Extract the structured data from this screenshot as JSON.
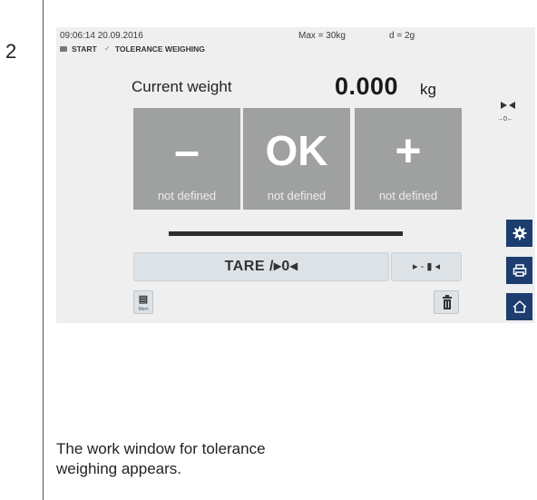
{
  "step": {
    "number": "2"
  },
  "status": {
    "datetime": "09:06:14 20.09.2016",
    "max": "Max = 30kg",
    "d": "d = 2g"
  },
  "app_bar": {
    "start_label": "START",
    "mode_label": "TOLERANCE WEIGHING"
  },
  "weight": {
    "label": "Current weight",
    "value": "0.000",
    "unit": "kg"
  },
  "indicators": {
    "zero_text": "→0←"
  },
  "tolerance": {
    "minus": {
      "symbol": "–",
      "status": "not defined"
    },
    "ok": {
      "symbol": "OK",
      "status": "not defined"
    },
    "plus": {
      "symbol": "+",
      "status": "not defined"
    }
  },
  "buttons": {
    "tare_label": "TARE /▸0◂",
    "adjust_label": "▸ - ▮ ◂",
    "mem_glyph": "▤",
    "mem_label": "Mem"
  },
  "side": [
    "settings-icon",
    "print-icon",
    "home-icon"
  ],
  "colors": {
    "box_gray": "#9fa0a0",
    "side_button": "#1c3d6e",
    "button_bg": "#dde2e6"
  },
  "caption": "The work window for tolerance weighing appears."
}
